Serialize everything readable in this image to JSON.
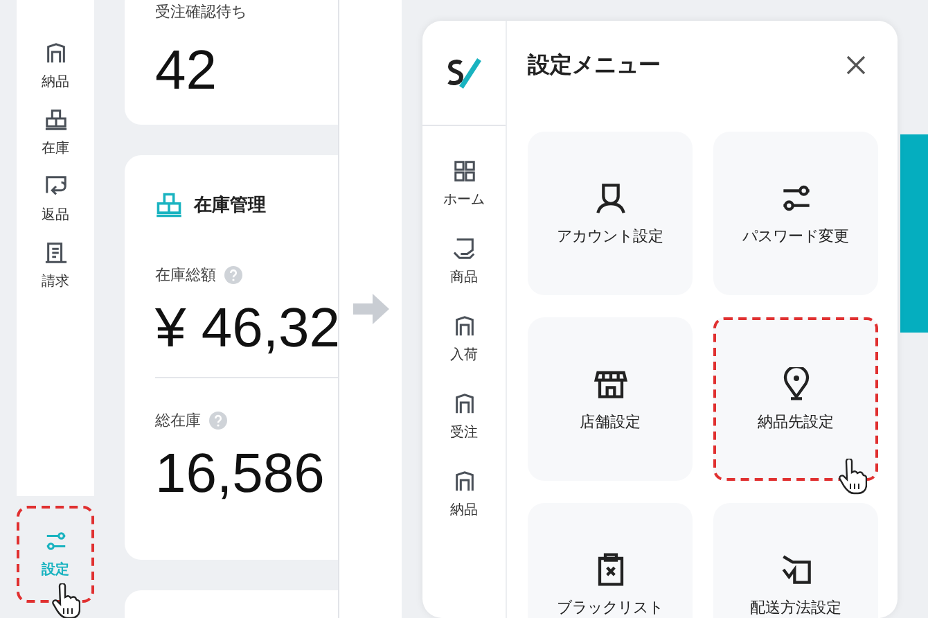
{
  "sidebar": {
    "items": [
      {
        "label": "納品",
        "selected": false,
        "highlighted": false
      },
      {
        "label": "在庫",
        "selected": false,
        "highlighted": false
      },
      {
        "label": "返品",
        "selected": false,
        "highlighted": false
      },
      {
        "label": "請求",
        "selected": false,
        "highlighted": false
      },
      {
        "label": "設定",
        "selected": true,
        "highlighted": true
      }
    ]
  },
  "cards": [
    {
      "kind": "stat",
      "label": "受注確認待ち",
      "value": "42"
    },
    {
      "kind": "section",
      "title": "在庫管理",
      "stats": [
        {
          "label": "在庫総額",
          "value": "¥ 46,32"
        },
        {
          "label": "総在庫",
          "value": "16,586"
        }
      ]
    },
    {
      "kind": "empty"
    }
  ],
  "settings_menu": {
    "title": "設定メニュー",
    "nav": [
      {
        "label": "ホーム"
      },
      {
        "label": "商品"
      },
      {
        "label": "入荷"
      },
      {
        "label": "受注"
      },
      {
        "label": "納品"
      }
    ],
    "tiles": [
      {
        "label": "アカウント設定",
        "highlighted": false
      },
      {
        "label": "パスワード変更",
        "highlighted": false
      },
      {
        "label": "店舗設定",
        "highlighted": false
      },
      {
        "label": "納品先設定",
        "highlighted": true
      },
      {
        "label": "ブラックリスト",
        "highlighted": false
      },
      {
        "label": "配送方法設定",
        "highlighted": false
      }
    ]
  }
}
